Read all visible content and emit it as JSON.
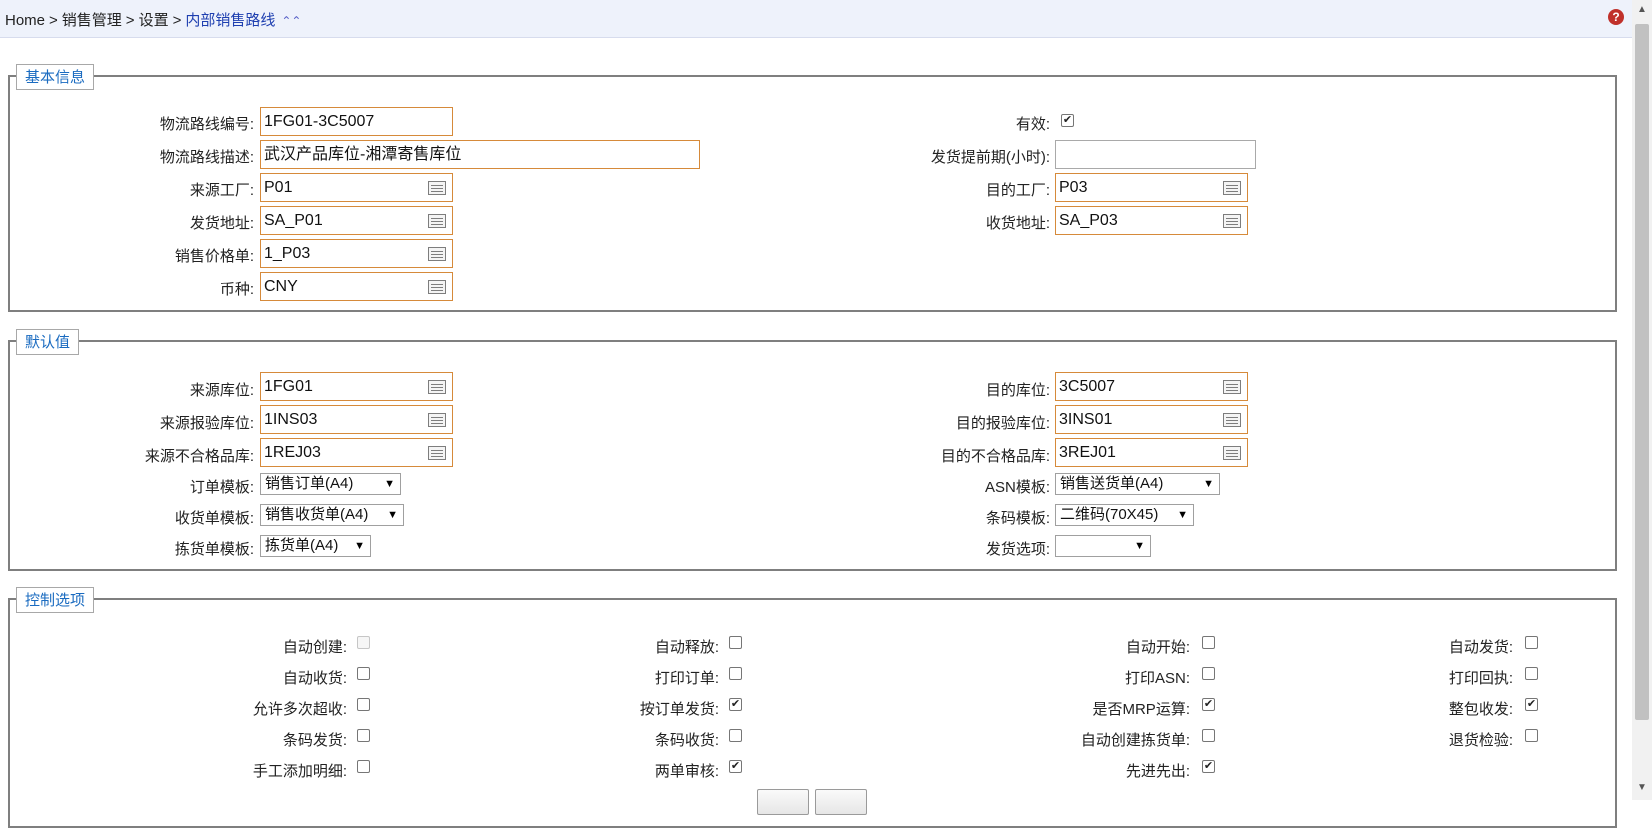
{
  "breadcrumb": {
    "home": "Home",
    "sep": ">",
    "level1": "销售管理",
    "level2": "设置",
    "current": "内部销售路线",
    "collapse_glyph": "⌃⌃"
  },
  "help_glyph": "?",
  "basic": {
    "legend": "基本信息",
    "route_no": {
      "label": "物流路线编号:",
      "value": "1FG01-3C5007"
    },
    "route_desc": {
      "label": "物流路线描述:",
      "value": "武汉产品库位-湘潭寄售库位"
    },
    "src_plant": {
      "label": "来源工厂:",
      "value": "P01"
    },
    "ship_addr": {
      "label": "发货地址:",
      "value": "SA_P01"
    },
    "price_list": {
      "label": "销售价格单:",
      "value": "1_P03"
    },
    "currency": {
      "label": "币种:",
      "value": "CNY"
    },
    "valid": {
      "label": "有效:",
      "checked": true
    },
    "lead_time": {
      "label": "发货提前期(小时):",
      "value": ""
    },
    "dst_plant": {
      "label": "目的工厂:",
      "value": "P03"
    },
    "recv_addr": {
      "label": "收货地址:",
      "value": "SA_P03"
    }
  },
  "defaults": {
    "legend": "默认值",
    "src_loc": {
      "label": "来源库位:",
      "value": "1FG01"
    },
    "src_insp": {
      "label": "来源报验库位:",
      "value": "1INS03"
    },
    "src_rej": {
      "label": "来源不合格品库:",
      "value": "1REJ03"
    },
    "order_tpl": {
      "label": "订单模板:",
      "value": "销售订单(A4)"
    },
    "recv_tpl": {
      "label": "收货单模板:",
      "value": "销售收货单(A4)"
    },
    "pick_tpl": {
      "label": "拣货单模板:",
      "value": "拣货单(A4)"
    },
    "dst_loc": {
      "label": "目的库位:",
      "value": "3C5007"
    },
    "dst_insp": {
      "label": "目的报验库位:",
      "value": "3INS01"
    },
    "dst_rej": {
      "label": "目的不合格品库:",
      "value": "3REJ01"
    },
    "asn_tpl": {
      "label": "ASN模板:",
      "value": "销售送货单(A4)"
    },
    "barcode_tpl": {
      "label": "条码模板:",
      "value": "二维码(70X45)"
    },
    "ship_opt": {
      "label": "发货选项:",
      "value": ""
    }
  },
  "control": {
    "legend": "控制选项",
    "col1": [
      {
        "label": "自动创建:",
        "checked": false,
        "disabled": true
      },
      {
        "label": "自动收货:",
        "checked": false
      },
      {
        "label": "允许多次超收:",
        "checked": false
      },
      {
        "label": "条码发货:",
        "checked": false
      },
      {
        "label": "手工添加明细:",
        "checked": false
      }
    ],
    "col2": [
      {
        "label": "自动释放:",
        "checked": false
      },
      {
        "label": "打印订单:",
        "checked": false
      },
      {
        "label": "按订单发货:",
        "checked": true
      },
      {
        "label": "条码收货:",
        "checked": false
      },
      {
        "label": "两单审核:",
        "checked": true
      }
    ],
    "col3": [
      {
        "label": "自动开始:",
        "checked": false
      },
      {
        "label": "打印ASN:",
        "checked": false
      },
      {
        "label": "是否MRP运算:",
        "checked": true
      },
      {
        "label": "自动创建拣货单:",
        "checked": false
      },
      {
        "label": "先进先出:",
        "checked": true
      }
    ],
    "col4": [
      {
        "label": "自动发货:",
        "checked": false
      },
      {
        "label": "打印回执:",
        "checked": false
      },
      {
        "label": "整包收发:",
        "checked": true
      },
      {
        "label": "退货检验:",
        "checked": false
      }
    ]
  },
  "select_arrow": "▼"
}
